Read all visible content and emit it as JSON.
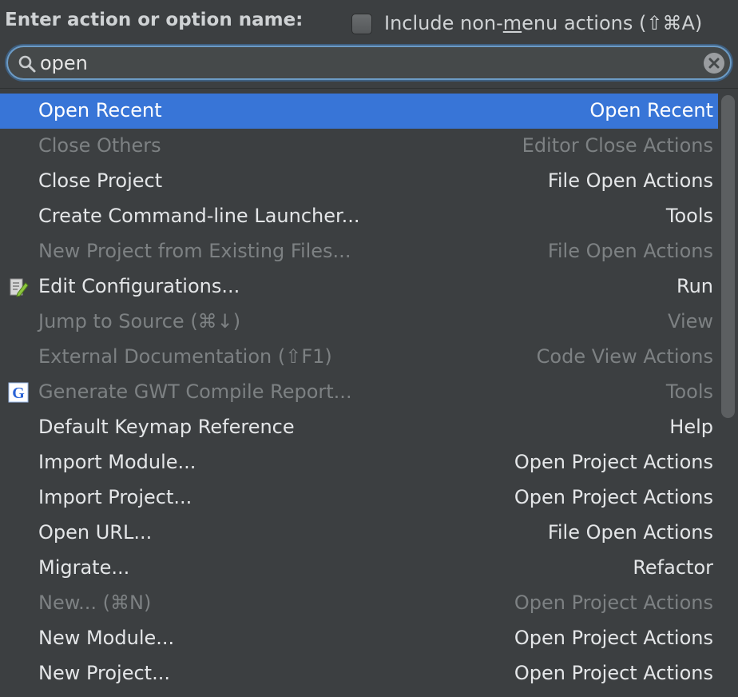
{
  "header": {
    "prompt": "Enter action or option name:",
    "include_prefix": "Include non-",
    "include_mnemonic": "m",
    "include_suffix": "enu actions (⇧⌘A)"
  },
  "search": {
    "value": "open",
    "icon": "magnifier-icon",
    "clear_icon": "clear-icon"
  },
  "colors": {
    "selection": "#3875d7",
    "background": "#3c3f41",
    "text": "#e4e6e8",
    "disabled_text": "#7d8183",
    "focus_ring": "#6c9bc5"
  },
  "results": [
    {
      "name": "Open Recent",
      "group": "Open Recent",
      "selected": true,
      "disabled": false,
      "icon": ""
    },
    {
      "name": "Close Others",
      "group": "Editor Close Actions",
      "selected": false,
      "disabled": true,
      "icon": ""
    },
    {
      "name": "Close Project",
      "group": "File Open Actions",
      "selected": false,
      "disabled": false,
      "icon": ""
    },
    {
      "name": "Create Command-line Launcher...",
      "group": "Tools",
      "selected": false,
      "disabled": false,
      "icon": ""
    },
    {
      "name": "New Project from Existing Files...",
      "group": "File Open Actions",
      "selected": false,
      "disabled": true,
      "icon": ""
    },
    {
      "name": "Edit Configurations...",
      "group": "Run",
      "selected": false,
      "disabled": false,
      "icon": "edit-config-icon"
    },
    {
      "name": "Jump to Source (⌘↓)",
      "group": "View",
      "selected": false,
      "disabled": true,
      "icon": ""
    },
    {
      "name": "External Documentation (⇧F1)",
      "group": "Code View Actions",
      "selected": false,
      "disabled": true,
      "icon": ""
    },
    {
      "name": "Generate GWT Compile Report...",
      "group": "Tools",
      "selected": false,
      "disabled": true,
      "icon": "gwt-icon"
    },
    {
      "name": "Default Keymap Reference",
      "group": "Help",
      "selected": false,
      "disabled": false,
      "icon": ""
    },
    {
      "name": "Import Module...",
      "group": "Open Project Actions",
      "selected": false,
      "disabled": false,
      "icon": ""
    },
    {
      "name": "Import Project...",
      "group": "Open Project Actions",
      "selected": false,
      "disabled": false,
      "icon": ""
    },
    {
      "name": "Open URL...",
      "group": "File Open Actions",
      "selected": false,
      "disabled": false,
      "icon": ""
    },
    {
      "name": "Migrate...",
      "group": "Refactor",
      "selected": false,
      "disabled": false,
      "icon": ""
    },
    {
      "name": "New... (⌘N)",
      "group": "Open Project Actions",
      "selected": false,
      "disabled": true,
      "icon": ""
    },
    {
      "name": "New Module...",
      "group": "Open Project Actions",
      "selected": false,
      "disabled": false,
      "icon": ""
    },
    {
      "name": "New Project...",
      "group": "Open Project Actions",
      "selected": false,
      "disabled": false,
      "icon": ""
    }
  ]
}
